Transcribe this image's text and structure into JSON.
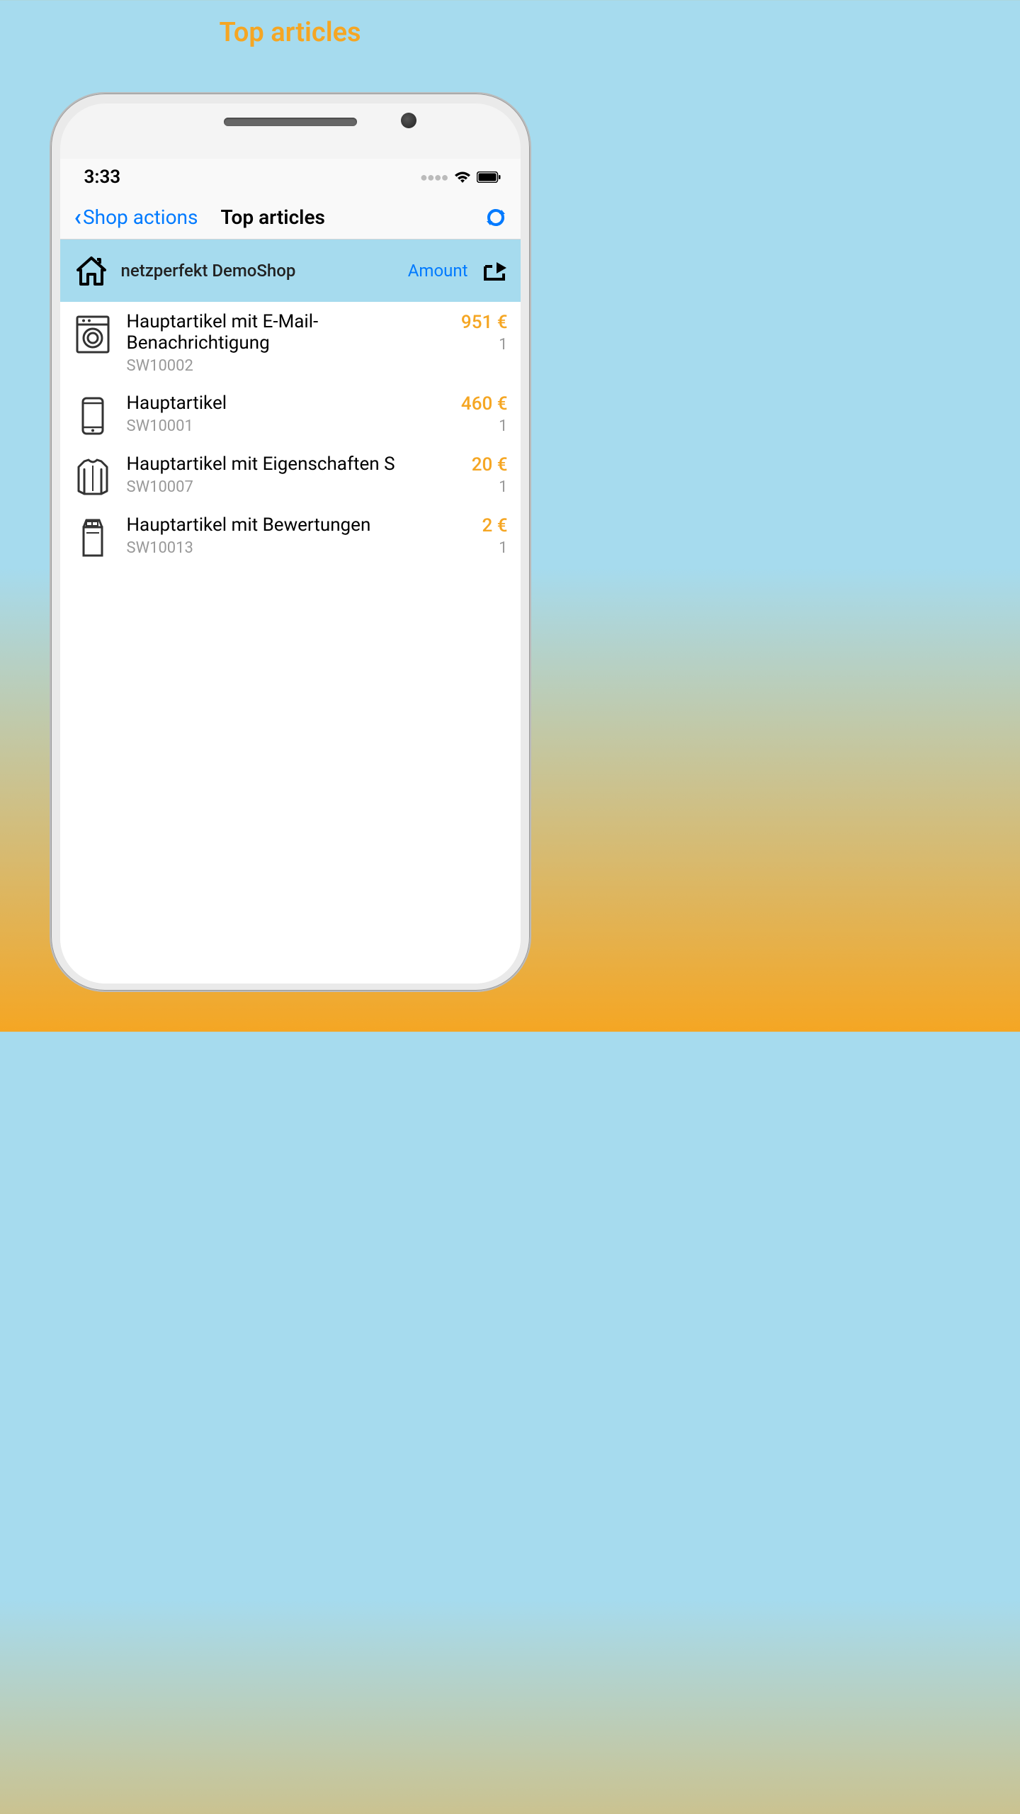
{
  "page": {
    "title": "Top articles"
  },
  "status_bar": {
    "time": "3:33"
  },
  "nav": {
    "back_label": "Shop actions",
    "title": "Top articles"
  },
  "subheader": {
    "shop_name": "netzperfekt DemoShop",
    "amount_label": "Amount"
  },
  "articles": [
    {
      "title": "Hauptartikel mit E-Mail-Benachrichtigung",
      "sku": "SW10002",
      "price": "951 €",
      "qty": "1",
      "icon": "washer"
    },
    {
      "title": "Hauptartikel",
      "sku": "SW10001",
      "price": "460 €",
      "qty": "1",
      "icon": "phone"
    },
    {
      "title": "Hauptartikel mit Eigenschaften S",
      "sku": "SW10007",
      "price": "20 €",
      "qty": "1",
      "icon": "shirt"
    },
    {
      "title": "Hauptartikel mit Bewertungen",
      "sku": "SW10013",
      "price": "2 €",
      "qty": "1",
      "icon": "chocolate"
    }
  ]
}
